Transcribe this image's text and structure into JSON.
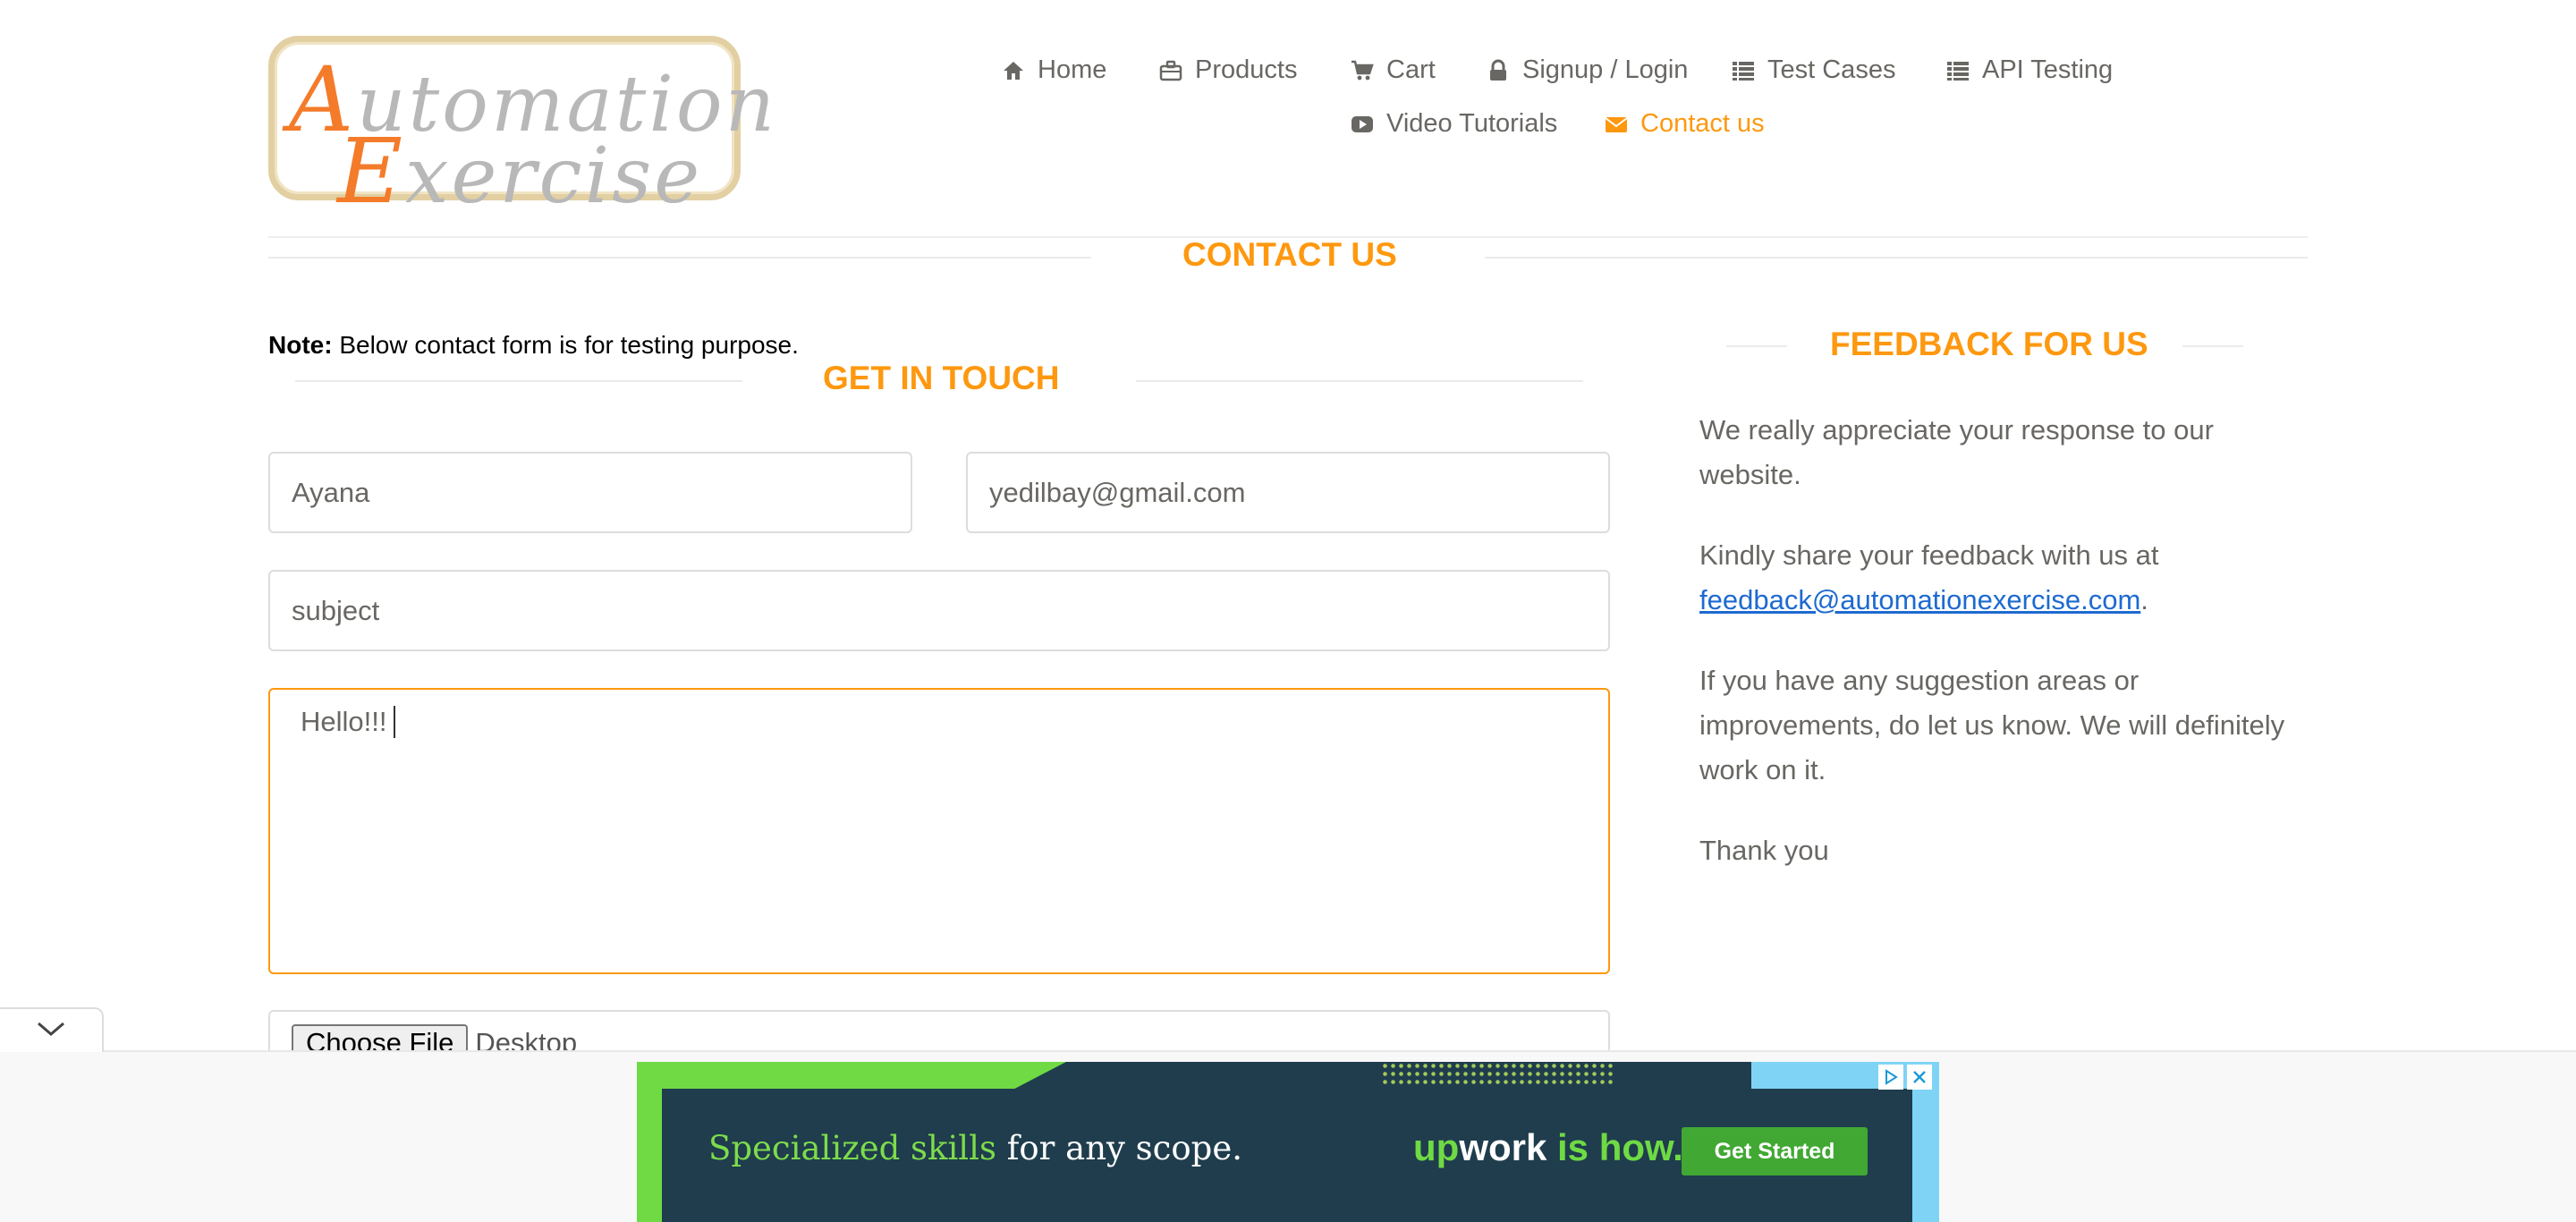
{
  "logo": {
    "line1_cap": "A",
    "line1_rest": "utomation",
    "line2_cap": "E",
    "line2_rest": "xercise"
  },
  "nav": [
    {
      "label": "Home",
      "icon": "home-icon"
    },
    {
      "label": "Products",
      "icon": "briefcase-icon"
    },
    {
      "label": "Cart",
      "icon": "cart-icon"
    },
    {
      "label": "Signup / Login",
      "icon": "lock-icon"
    },
    {
      "label": "Test Cases",
      "icon": "list-icon"
    },
    {
      "label": "API Testing",
      "icon": "list-icon"
    },
    {
      "label": "Video Tutorials",
      "icon": "youtube-icon"
    },
    {
      "label": "Contact us",
      "icon": "envelope-icon",
      "active": true
    }
  ],
  "page_title": "CONTACT US",
  "note": {
    "bold": "Note:",
    "text": " Below contact form is for testing purpose."
  },
  "form": {
    "title": "GET IN TOUCH",
    "name_value": "Ayana",
    "email_value": "yedilbay@gmail.com",
    "subject_placeholder": "subject",
    "message_value": "Hello!!!",
    "file_button": "Choose File",
    "file_name": "Desktop"
  },
  "feedback": {
    "title": "FEEDBACK FOR US",
    "p1": "We really appreciate your response to our website.",
    "p2_text": "Kindly share your feedback with us at",
    "p2_link": "feedback@automationexercise.com",
    "p2_end": ".",
    "p3": "If you have any suggestion areas or improvements, do let us know. We will definitely work on it.",
    "p4": "Thank you"
  },
  "ad": {
    "headline_green": "Specialized skills",
    "headline_rest": " for any scope.",
    "brand_up": "up",
    "brand_work": "work",
    "brand_is_how": " is how.",
    "cta": "Get Started"
  },
  "colors": {
    "accent": "#fe980f",
    "link": "#1e6ad0",
    "text": "#696763",
    "ad_bg": "#1f3d4d",
    "ad_green": "#6fda44"
  }
}
